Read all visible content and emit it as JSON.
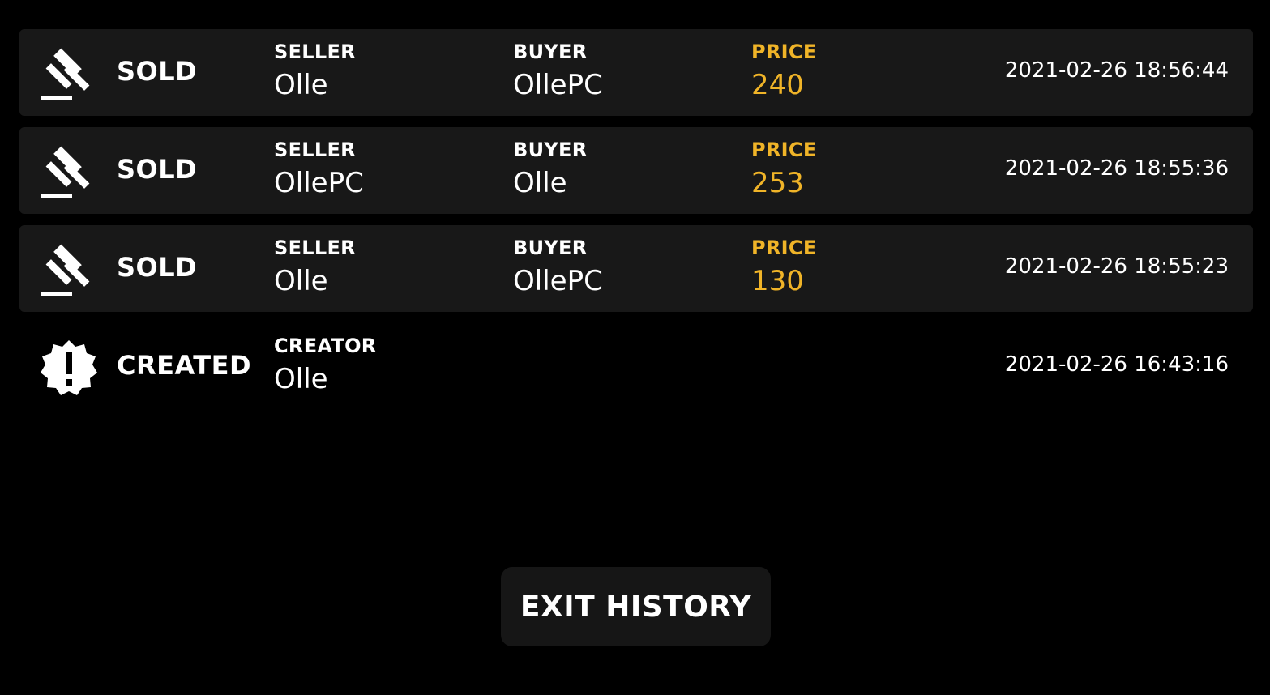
{
  "history": [
    {
      "type": "SOLD",
      "icon": "gavel-icon",
      "seller_label": "SELLER",
      "seller": "Olle",
      "buyer_label": "BUYER",
      "buyer": "OllePC",
      "price_label": "PRICE",
      "price": "240",
      "timestamp": "2021-02-26 18:56:44"
    },
    {
      "type": "SOLD",
      "icon": "gavel-icon",
      "seller_label": "SELLER",
      "seller": "OllePC",
      "buyer_label": "BUYER",
      "buyer": "Olle",
      "price_label": "PRICE",
      "price": "253",
      "timestamp": "2021-02-26 18:55:36"
    },
    {
      "type": "SOLD",
      "icon": "gavel-icon",
      "seller_label": "SELLER",
      "seller": "Olle",
      "buyer_label": "BUYER",
      "buyer": "OllePC",
      "price_label": "PRICE",
      "price": "130",
      "timestamp": "2021-02-26 18:55:23"
    },
    {
      "type": "CREATED",
      "icon": "alert-badge-icon",
      "creator_label": "CREATOR",
      "creator": "Olle",
      "timestamp": "2021-02-26 16:43:16"
    }
  ],
  "exit_button_label": "EXIT HISTORY",
  "colors": {
    "background": "#000000",
    "row_background": "#181818",
    "price_accent": "#f0b428",
    "text": "#ffffff",
    "button_background": "#161616"
  }
}
